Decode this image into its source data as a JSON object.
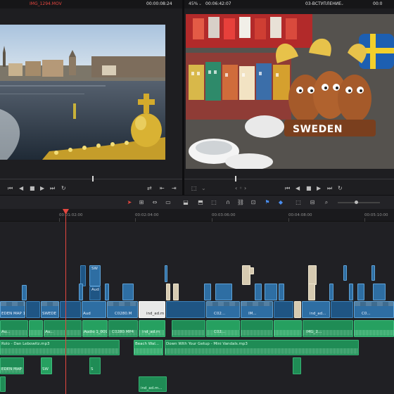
{
  "source_viewer": {
    "clip_name": "IMG_1294.MOV",
    "timecode": "00:00:08:24"
  },
  "program_viewer": {
    "zoom": "45%",
    "timecode": "00:06:42:07",
    "timeline_name": "03-ВСТУПЛЕНИЕ",
    "overlay_text": "SWEDEN"
  },
  "timeline": {
    "ruler_timecodes": [
      "00:01:02:00",
      "00:02:04:00",
      "00:03:06:00",
      "00:04:08:00",
      "00:05:10:00"
    ],
    "clips": {
      "v_sw_clip": "SW",
      "v_aud_label": "Aud",
      "v_ovlay": "SW",
      "v_sweden1": "EDEN MAP 1",
      "v_sweden2": "SWEDE",
      "v_audio": "Aud",
      "v_c0280": "C0280.M",
      "v_ind": "ind_ad.m",
      "v_c02": "C02...",
      "v_im": "IM...",
      "v_ind2": "ind_ad...",
      "v_c02b": "C0...",
      "a_audio1": "Audio 1_009",
      "a_c0280": "C0280.MP4",
      "a_ind": "ind_ad.m",
      "a_c02": "C02...",
      "a_im": "IMG_2...",
      "a_au": "Au...",
      "a_au2": "Au...",
      "m_lebowski": "Rolo - Dan Lebowitz.mp3",
      "m_beach": "Beach Wal...",
      "m_getup": "Down With Your Getup - Mini Vandals.mp3",
      "l_sweden": "EDEN MAP 1",
      "l_sw": "SW",
      "l_s": "S",
      "l_ind": "ind_ad.m..."
    }
  },
  "colors": {
    "playhead": "#e5473f",
    "video_clip": "#2e6ea3",
    "audio_clip": "#1f8c55"
  }
}
